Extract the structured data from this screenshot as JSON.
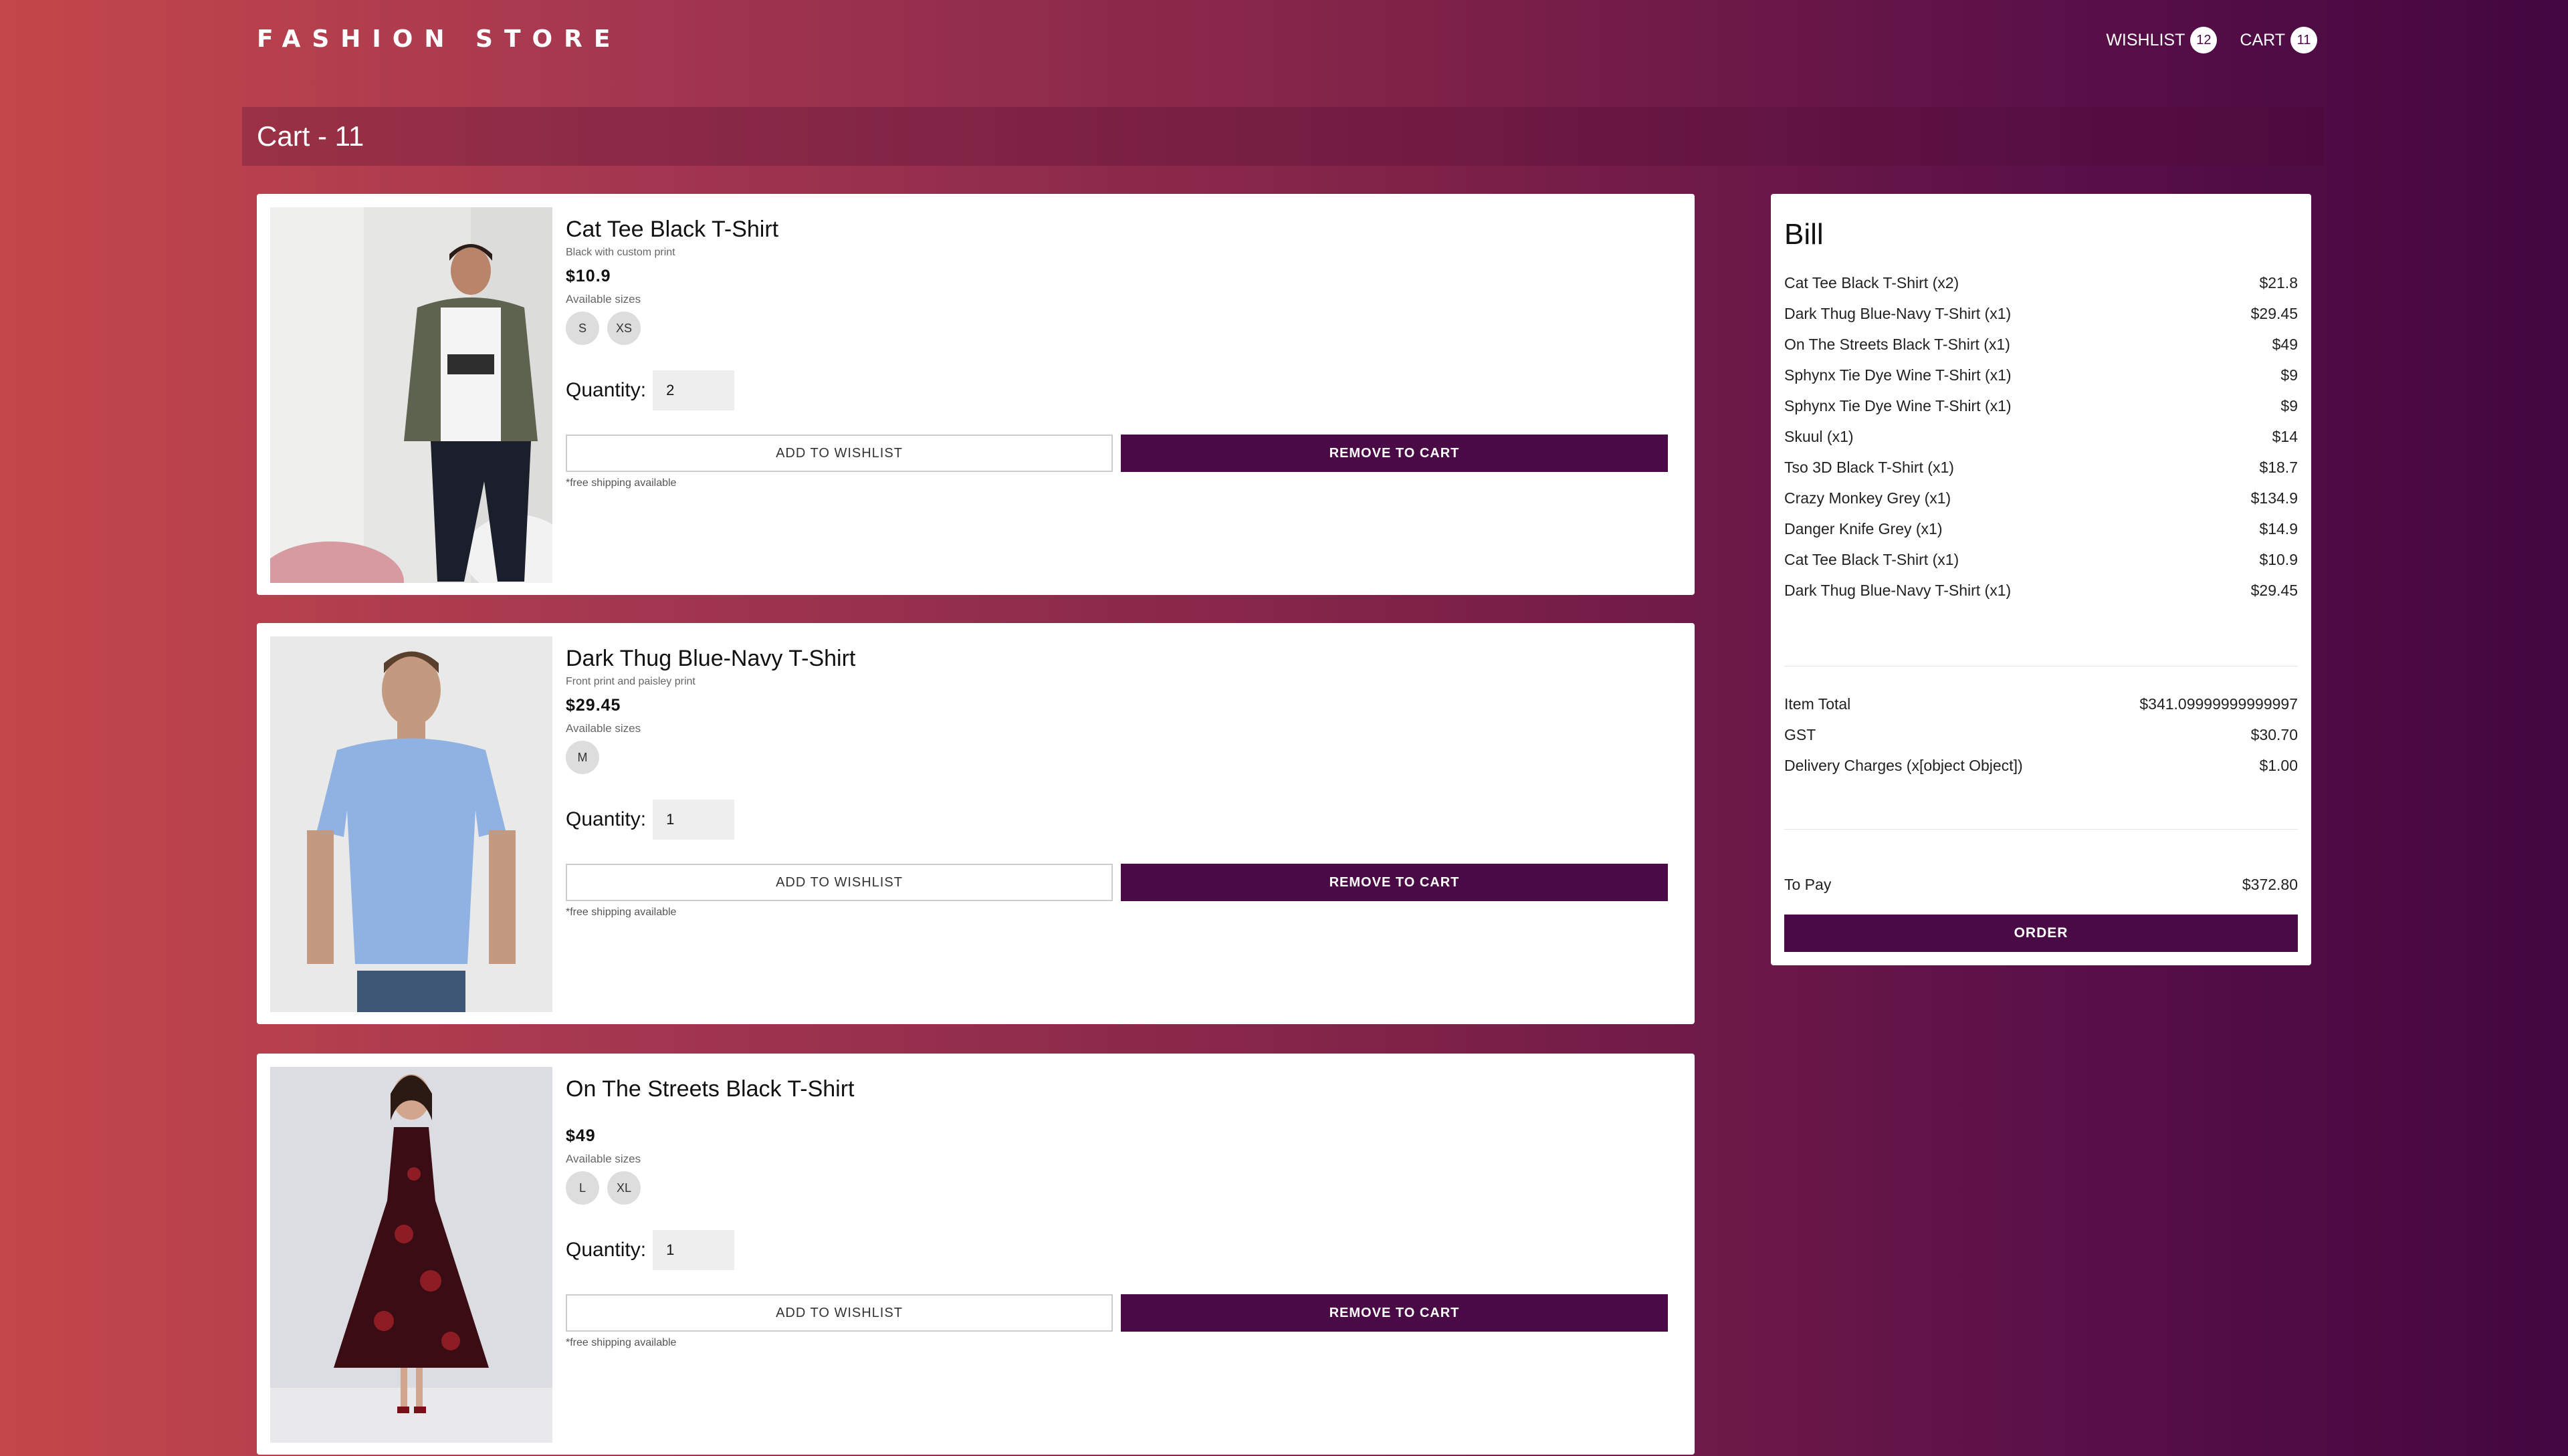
{
  "header": {
    "logo": "FASHION STORE",
    "wishlist_label": "WISHLIST",
    "wishlist_count": "12",
    "cart_label": "CART",
    "cart_count": "11"
  },
  "cart_title": "Cart - 11",
  "colors": {
    "accent": "#4a0a45",
    "gradient_start": "#c4474a",
    "gradient_end": "#430640"
  },
  "items": [
    {
      "name": "Cat Tee Black T-Shirt",
      "description": "Black with custom print",
      "price": "$10.9",
      "available_sizes_label": "Available sizes",
      "sizes": [
        "S",
        "XS"
      ],
      "quantity_label": "Quantity:",
      "quantity": "2",
      "wishlist_button": "ADD TO WISHLIST",
      "remove_button": "REMOVE TO CART",
      "shipping_note": "*free shipping available"
    },
    {
      "name": "Dark Thug Blue-Navy T-Shirt",
      "description": "Front print and paisley print",
      "price": "$29.45",
      "available_sizes_label": "Available sizes",
      "sizes": [
        "M"
      ],
      "quantity_label": "Quantity:",
      "quantity": "1",
      "wishlist_button": "ADD TO WISHLIST",
      "remove_button": "REMOVE TO CART",
      "shipping_note": "*free shipping available"
    },
    {
      "name": "On The Streets Black T-Shirt",
      "description": "",
      "price": "$49",
      "available_sizes_label": "Available sizes",
      "sizes": [
        "L",
        "XL"
      ],
      "quantity_label": "Quantity:",
      "quantity": "1",
      "wishlist_button": "ADD TO WISHLIST",
      "remove_button": "REMOVE TO CART",
      "shipping_note": "*free shipping available"
    }
  ],
  "bill": {
    "title": "Bill",
    "lines": [
      {
        "label": "Cat Tee Black T-Shirt (x2)",
        "amount": "$21.8"
      },
      {
        "label": "Dark Thug Blue-Navy T-Shirt (x1)",
        "amount": "$29.45"
      },
      {
        "label": "On The Streets Black T-Shirt (x1)",
        "amount": "$49"
      },
      {
        "label": "Sphynx Tie Dye Wine T-Shirt (x1)",
        "amount": "$9"
      },
      {
        "label": "Sphynx Tie Dye Wine T-Shirt (x1)",
        "amount": "$9"
      },
      {
        "label": "Skuul (x1)",
        "amount": "$14"
      },
      {
        "label": "Tso 3D Black T-Shirt (x1)",
        "amount": "$18.7"
      },
      {
        "label": "Crazy Monkey Grey (x1)",
        "amount": "$134.9"
      },
      {
        "label": "Danger Knife Grey (x1)",
        "amount": "$14.9"
      },
      {
        "label": "Cat Tee Black T-Shirt (x1)",
        "amount": "$10.9"
      },
      {
        "label": "Dark Thug Blue-Navy T-Shirt (x1)",
        "amount": "$29.45"
      }
    ],
    "item_total_label": "Item Total",
    "item_total": "$341.09999999999997",
    "gst_label": "GST",
    "gst": "$30.70",
    "delivery_label": "Delivery Charges (x[object Object])",
    "delivery": "$1.00",
    "to_pay_label": "To Pay",
    "to_pay": "$372.80",
    "order_button": "ORDER"
  }
}
